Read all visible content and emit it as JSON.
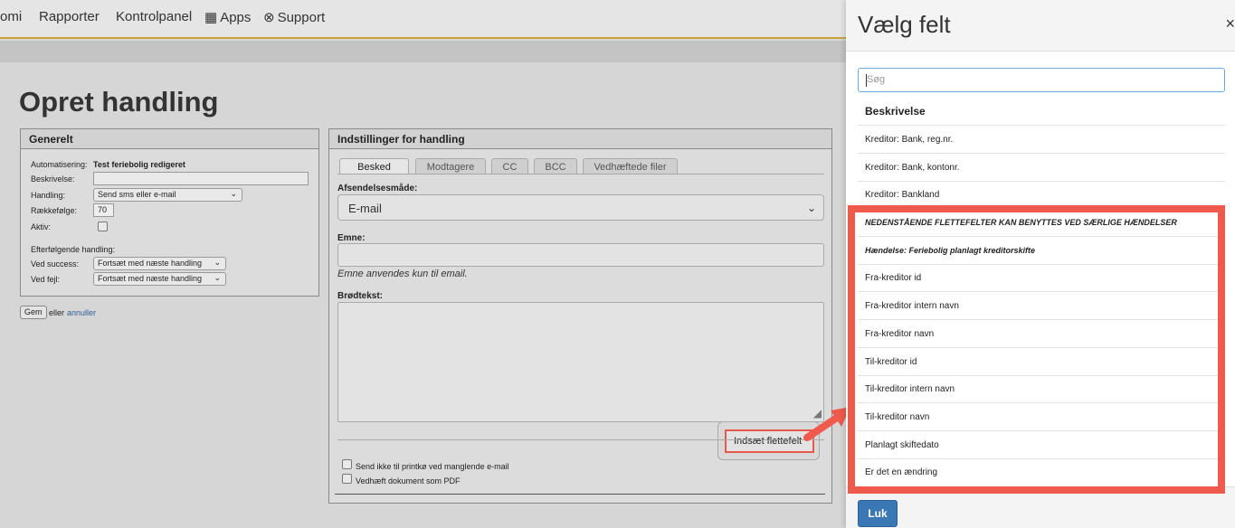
{
  "nav": {
    "items": [
      "omi",
      "Rapporter",
      "Kontrolpanel",
      "Apps",
      "Support"
    ]
  },
  "page": {
    "title": "Opret handling"
  },
  "general": {
    "title": "Generelt",
    "automation_label": "Automatisering:",
    "automation_value": "Test feriebolig redigeret",
    "description_label": "Beskrivelse:",
    "action_label": "Handling:",
    "action_value": "Send sms eller e-mail",
    "order_label": "Rækkefølge:",
    "order_value": "70",
    "active_label": "Aktiv:",
    "following_label": "Efterfølgende handling:",
    "success_label": "Ved success:",
    "success_value": "Fortsæt med næste handling",
    "error_label": "Ved fejl:",
    "error_value": "Fortsæt med næste handling"
  },
  "footer_actions": {
    "save": "Gem",
    "or": "eller",
    "cancel": "annuller"
  },
  "settings": {
    "title": "Indstillinger for handling",
    "tabs": [
      "Besked",
      "Modtagere",
      "CC",
      "BCC",
      "Vedhæftede filer"
    ],
    "send_method_label": "Afsendelsesmåde:",
    "send_method_value": "E-mail",
    "subject_label": "Emne:",
    "subject_hint": "Emne anvendes kun til email.",
    "body_label": "Brødtekst:",
    "insert_merge_field": "Indsæt flettefelt",
    "checkbox_no_print": "Send ikke til printkø ved manglende e-mail",
    "checkbox_pdf": "Vedhæft dokument som PDF"
  },
  "modal": {
    "title": "Vælg felt",
    "close": "×",
    "search_placeholder": "Søg",
    "options": [
      "Beskrivelse",
      "Kreditor: Bank, reg.nr.",
      "Kreditor: Bank, kontonr.",
      "Kreditor: Bankland",
      "NEDENSTÅENDE FLETTEFELTER KAN BENYTTES VED SÆRLIGE HÆNDELSER",
      "Hændelse: Feriebolig planlagt kreditorskifte",
      "Fra-kreditor id",
      "Fra-kreditor intern navn",
      "Fra-kreditor navn",
      "Til-kreditor id",
      "Til-kreditor intern navn",
      "Til-kreditor navn",
      "Planlagt skiftedato",
      "Er det en ændring"
    ],
    "close_button": "Luk"
  },
  "colors": {
    "highlight": "#ef5a4c",
    "primary": "#3a78b5",
    "nav_accent": "#c9a43a"
  }
}
